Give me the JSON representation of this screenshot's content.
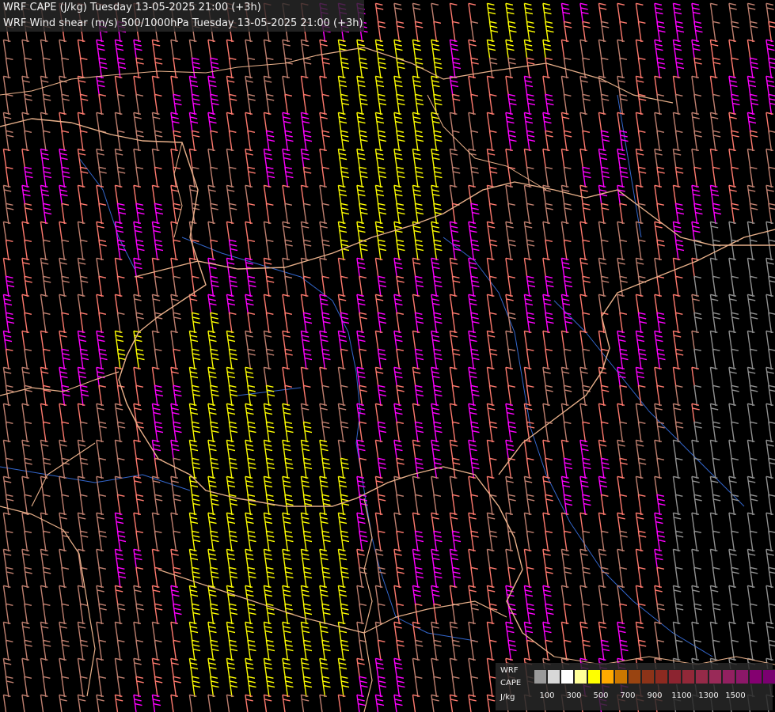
{
  "header": {
    "line1": "WRF CAPE (J/kg) Tuesday 13-05-2025 21:00 (+3h)",
    "line2": "WRF Wind shear (m/s) 500/1000hPa Tuesday 13-05-2025 21:00 (+3h)"
  },
  "legend": {
    "label_model": "WRF",
    "label_field": "CAPE",
    "label_unit": "J/kg",
    "colors": [
      "#9a9a9a",
      "#d8d8d8",
      "#ffffff",
      "#ffff99",
      "#ffff00",
      "#ffaa00",
      "#cc7700",
      "#994411",
      "#8c3318",
      "#8c2a20",
      "#8c2430",
      "#922838",
      "#952a48",
      "#992a58",
      "#922060",
      "#8c1868",
      "#840070",
      "#7a0070"
    ],
    "tick_labels": [
      "100",
      "300",
      "500",
      "700",
      "900",
      "1100",
      "1300",
      "1500"
    ]
  },
  "map_colors": {
    "background": "#000000",
    "borders": "#e8b08a",
    "rivers": "#3366cc",
    "barb_low": "#c08070",
    "barb_mid": "#ff7a6e",
    "barb_high": "#ff00ff",
    "barb_strong": "#ffff00",
    "barb_gray": "#909090"
  }
}
